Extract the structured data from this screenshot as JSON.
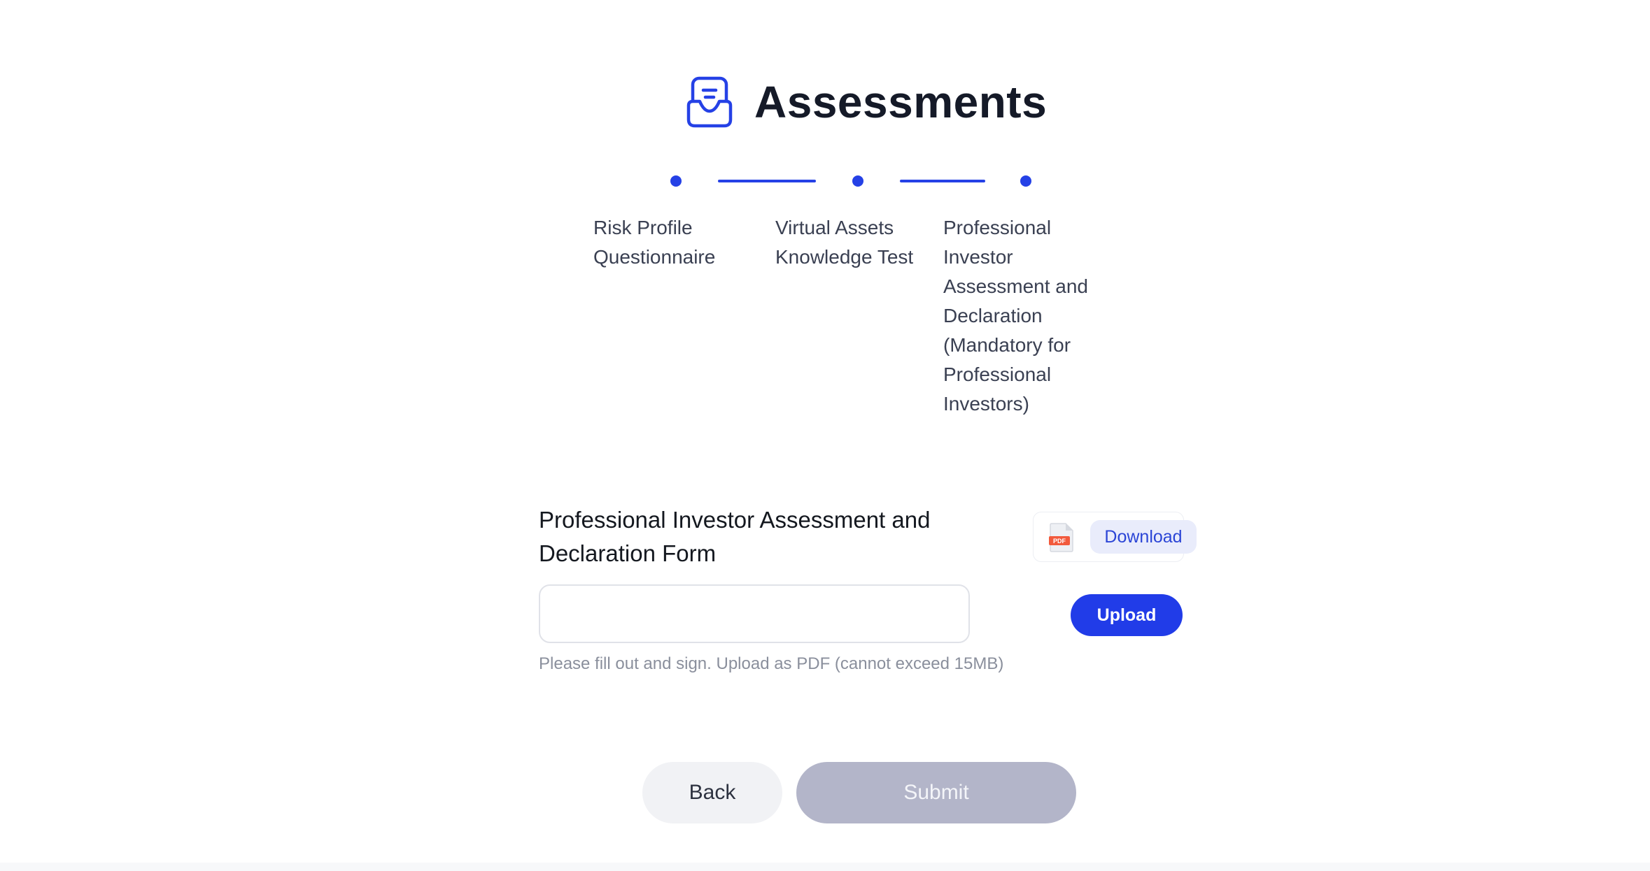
{
  "header": {
    "title": "Assessments",
    "icon": "assessment-inbox-icon"
  },
  "stepper": {
    "steps": [
      {
        "label": "Risk Profile Questionnaire"
      },
      {
        "label": "Virtual Assets Knowledge Test"
      },
      {
        "label": "Professional Investor Assessment and Declaration (Mandatory for Professional Investors)"
      }
    ]
  },
  "form": {
    "title": "Professional Investor Assessment and Declaration Form",
    "download_label": "Download",
    "pdf_icon": "pdf-file-icon",
    "upload_value": "",
    "upload_label": "Upload",
    "hint": "Please fill out and sign. Upload as PDF (cannot exceed 15MB)"
  },
  "actions": {
    "back_label": "Back",
    "submit_label": "Submit"
  },
  "colors": {
    "accent": "#2541e6",
    "submit_disabled": "#b3b5c9",
    "back_bg": "#f1f2f5",
    "download_bg": "#e9ecfb"
  }
}
